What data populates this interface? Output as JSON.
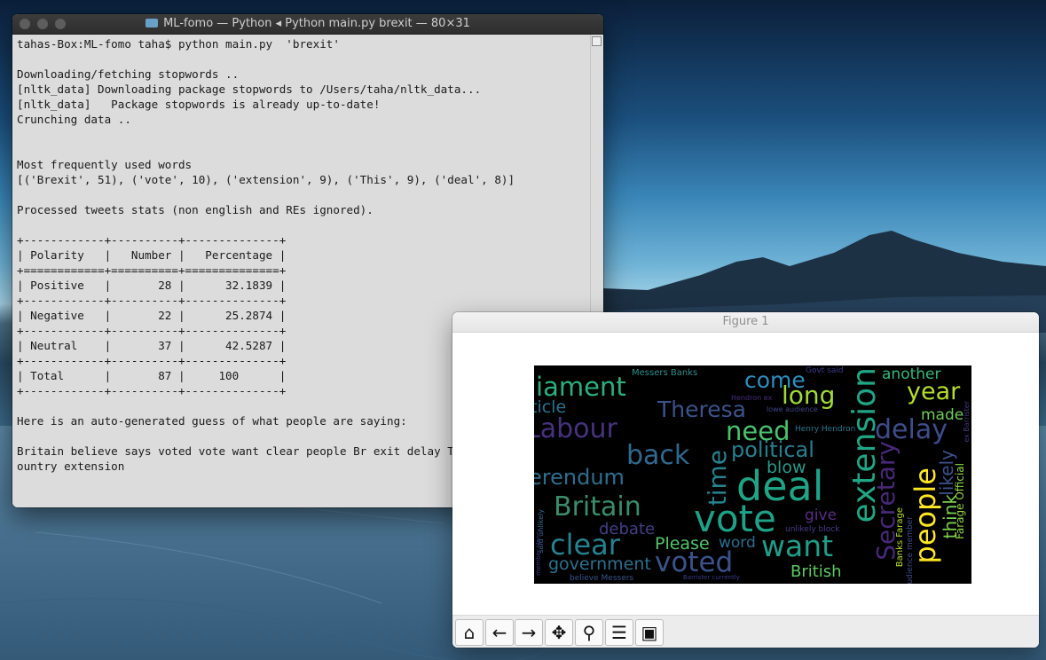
{
  "terminal": {
    "title": "ML-fomo — Python ◂ Python main.py brexit — 80×31",
    "lines": [
      "tahas-Box:ML-fomo taha$ python main.py  'brexit'",
      "",
      "Downloading/fetching stopwords ..",
      "[nltk_data] Downloading package stopwords to /Users/taha/nltk_data...",
      "[nltk_data]   Package stopwords is already up-to-date!",
      "Crunching data ..",
      "",
      "",
      "Most frequently used words",
      "[('Brexit', 51), ('vote', 10), ('extension', 9), ('This', 9), ('deal', 8)]",
      "",
      "Processed tweets stats (non english and REs ignored).",
      "",
      "+------------+----------+--------------+",
      "| Polarity   |   Number |   Percentage |",
      "+============+==========+==============+",
      "| Positive   |       28 |      32.1839 |",
      "+------------+----------+--------------+",
      "| Negative   |       22 |      25.2874 |",
      "+------------+----------+--------------+",
      "| Neutral    |       37 |      42.5287 |",
      "+------------+----------+--------------+",
      "| Total      |       87 |     100      |",
      "+------------+----------+--------------+",
      "",
      "Here is an auto-generated guess of what people are saying:",
      "",
      "Britain believe says voted vote want clear people Br exit delay This They deal c",
      "ountry extension"
    ]
  },
  "figure": {
    "title": "Figure 1",
    "toolbar": [
      {
        "icon": "home-icon",
        "glyph": "⌂"
      },
      {
        "icon": "back-icon",
        "glyph": "←"
      },
      {
        "icon": "forward-icon",
        "glyph": "→"
      },
      {
        "icon": "pan-icon",
        "glyph": "✥"
      },
      {
        "icon": "zoom-icon",
        "glyph": "⚲"
      },
      {
        "icon": "configure-icon",
        "glyph": "☰"
      },
      {
        "icon": "save-icon",
        "glyph": "▣"
      }
    ]
  },
  "wordcloud": {
    "words": [
      {
        "text": "Messers Banks",
        "color": "#2f8f8a"
      },
      {
        "text": "Govt said",
        "color": "#3a3a8a"
      },
      {
        "text": "another",
        "color": "#35b779"
      },
      {
        "text": "liament",
        "color": "#2bb07f"
      },
      {
        "text": "come",
        "color": "#2c8ec0"
      },
      {
        "text": "year",
        "color": "#b5de2b"
      },
      {
        "text": "long",
        "color": "#a0da39"
      },
      {
        "text": "Theresa",
        "color": "#3b528b"
      },
      {
        "text": "ticle",
        "color": "#2c728e"
      },
      {
        "text": "Hendron ex",
        "color": "#472d7b"
      },
      {
        "text": "lowe audience",
        "color": "#414487"
      },
      {
        "text": "made",
        "color": "#6ece58"
      },
      {
        "text": "extension",
        "color": "#21a685"
      },
      {
        "text": "Labour",
        "color": "#46327e"
      },
      {
        "text": "need",
        "color": "#4ac16d"
      },
      {
        "text": "Henry Hendron",
        "color": "#2a788e"
      },
      {
        "text": "delay",
        "color": "#3e4c8a"
      },
      {
        "text": "political",
        "color": "#277f8e"
      },
      {
        "text": "back",
        "color": "#31688e"
      },
      {
        "text": "time",
        "color": "#26828e"
      },
      {
        "text": "blow",
        "color": "#2a9a8a"
      },
      {
        "text": "erendum",
        "color": "#2e6e8e"
      },
      {
        "text": "deal",
        "color": "#20a486"
      },
      {
        "text": "Secretary",
        "color": "#482878"
      },
      {
        "text": "people",
        "color": "#fde725"
      },
      {
        "text": "likely",
        "color": "#3b528b"
      },
      {
        "text": "Britain",
        "color": "#3b8c6a"
      },
      {
        "text": "vote",
        "color": "#1fa187"
      },
      {
        "text": "give",
        "color": "#5a2d82"
      },
      {
        "text": "think",
        "color": "#7ad151"
      },
      {
        "text": "Farage Official",
        "color": "#8fd744"
      },
      {
        "text": "debate",
        "color": "#433e85"
      },
      {
        "text": "Please",
        "color": "#52c569"
      },
      {
        "text": "word",
        "color": "#2a6f8e"
      },
      {
        "text": "unlikely block",
        "color": "#4b3c8a"
      },
      {
        "text": "clear",
        "color": "#26828e"
      },
      {
        "text": "want",
        "color": "#1f9e89"
      },
      {
        "text": "government",
        "color": "#2d708e"
      },
      {
        "text": "voted",
        "color": "#3b528b"
      },
      {
        "text": "British",
        "color": "#5ec962"
      },
      {
        "text": "said unlikely",
        "color": "#2e6b8e"
      },
      {
        "text": "believe Messers",
        "color": "#3a548c"
      },
      {
        "text": "Banks Farage",
        "color": "#b5de2b"
      },
      {
        "text": "audience member",
        "color": "#3e4a89"
      },
      {
        "text": "member Henry",
        "color": "#3a3a8a"
      },
      {
        "text": "ex Barrister",
        "color": "#443983"
      },
      {
        "text": "Barrister currently",
        "color": "#3a3a8a"
      }
    ]
  }
}
